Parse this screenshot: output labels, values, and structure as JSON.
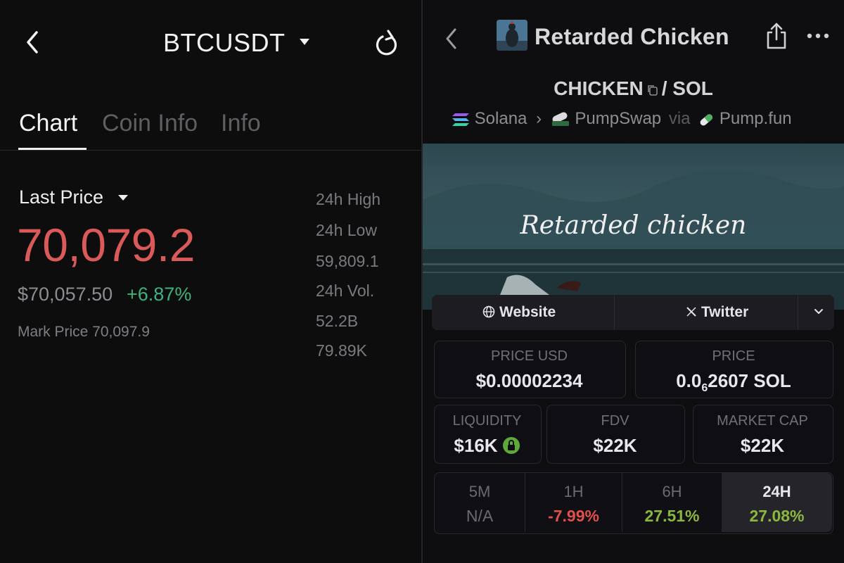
{
  "left": {
    "title": "BTCUSDT",
    "tabs": [
      "Chart",
      "Coin Info",
      "Info"
    ],
    "last_price_label": "Last Price",
    "last_price": "70,079.2",
    "usd_price": "$70,057.50",
    "change_pct": "+6.87%",
    "mark_price": "Mark Price 70,097.9",
    "stats": [
      "24h High",
      "24h Low",
      "59,809.1",
      "24h Vol.",
      "52.2B",
      "79.89K"
    ],
    "colors": {
      "price_red": "#d95a58",
      "change_green": "#3db27d"
    },
    "icons": {
      "back": "chevron-left-icon",
      "dropdown": "caret-down-icon",
      "refresh": "refresh-icon"
    }
  },
  "right": {
    "title": "Retarded Chicken",
    "pair_base": "CHICKEN",
    "pair_quote": "/ SOL",
    "chain": "Solana",
    "dex": "PumpSwap",
    "via": "via",
    "launchpad": "Pump.fun",
    "banner_text": "Retarded chicken",
    "links": {
      "website": "Website",
      "twitter": "Twitter"
    },
    "price_usd_label": "PRICE USD",
    "price_usd": "$0.00002234",
    "price_label": "PRICE",
    "price_sol_prefix": "0.0",
    "price_sol_sub": "6",
    "price_sol_suffix": "2607 SOL",
    "liquidity_label": "LIQUIDITY",
    "liquidity": "$16K",
    "fdv_label": "FDV",
    "fdv": "$22K",
    "mcap_label": "MARKET CAP",
    "mcap": "$22K",
    "timeframes": [
      {
        "label": "5M",
        "value": "N/A"
      },
      {
        "label": "1H",
        "value": "-7.99%"
      },
      {
        "label": "6H",
        "value": "27.51%"
      },
      {
        "label": "24H",
        "value": "27.08%"
      }
    ],
    "colors": {
      "negative": "#e0504a",
      "positive": "#8bb83c",
      "lock_green": "#5fa83a"
    },
    "icons": {
      "back": "chevron-left-icon",
      "share": "share-icon",
      "more": "more-icon",
      "copy": "copy-icon",
      "globe": "globe-icon",
      "x": "x-logo-icon",
      "expand": "chevron-down-icon",
      "lock": "lock-icon"
    }
  }
}
